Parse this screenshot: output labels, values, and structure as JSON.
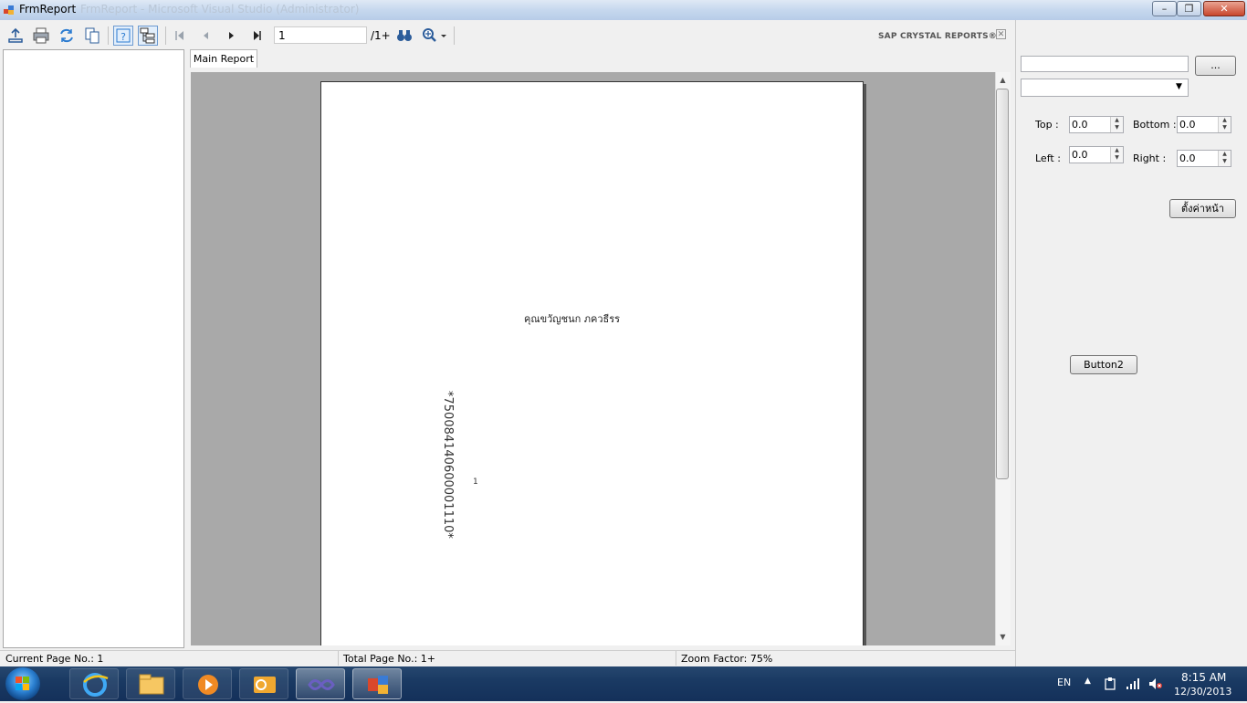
{
  "window": {
    "title": "FrmReport",
    "ghost_title": "FrmReport - Microsoft Visual Studio (Administrator)",
    "minimize": "–",
    "maximize": "❐",
    "close": "✕"
  },
  "viewer": {
    "toolbar": {
      "page_value": "1",
      "page_total": "/1+",
      "brand": "SAP CRYSTAL REPORTS®",
      "close_glyph": "✕"
    },
    "tabs": [
      {
        "label": "Main Report"
      }
    ],
    "report": {
      "customer_name": "คุณขวัญชนก ภควธีรร",
      "barcode": "*750084140600001110*",
      "page_number": "1"
    },
    "status": {
      "current_page": "Current Page No.: 1",
      "total_page": "Total Page No.: 1+",
      "zoom": "Zoom Factor: 75%"
    }
  },
  "margins_panel": {
    "browse_label": "...",
    "top_label": "Top :",
    "bottom_label": "Bottom :",
    "left_label": "Left :",
    "right_label": "Right :",
    "top_value": "0.0",
    "bottom_value": "0.0",
    "left_value": "0.0",
    "right_value": "0.0",
    "setup_button": "ตั้งค่าหน้า",
    "button2": "Button2"
  },
  "taskbar": {
    "language": "EN",
    "time": "8:15 AM",
    "date": "12/30/2013"
  },
  "colors": {
    "preview_background": "#a9a9a9",
    "taskbar": "#1a3a63"
  }
}
